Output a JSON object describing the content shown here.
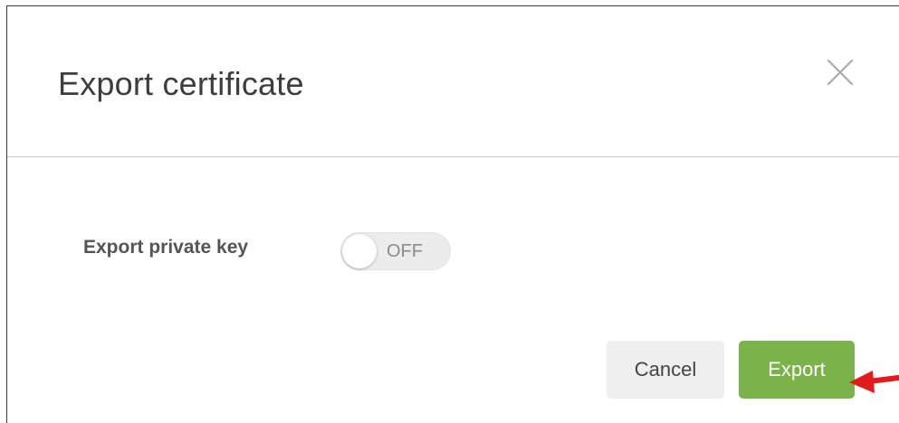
{
  "dialog": {
    "title": "Export certificate"
  },
  "form": {
    "export_private_key": {
      "label": "Export private key",
      "toggle_state": "OFF"
    }
  },
  "footer": {
    "cancel_label": "Cancel",
    "export_label": "Export"
  },
  "colors": {
    "accent_green": "#7ab34a",
    "annotation_arrow": "#e3191b"
  },
  "icons": {
    "close": "close-icon",
    "annotation": "red-arrow-icon"
  }
}
